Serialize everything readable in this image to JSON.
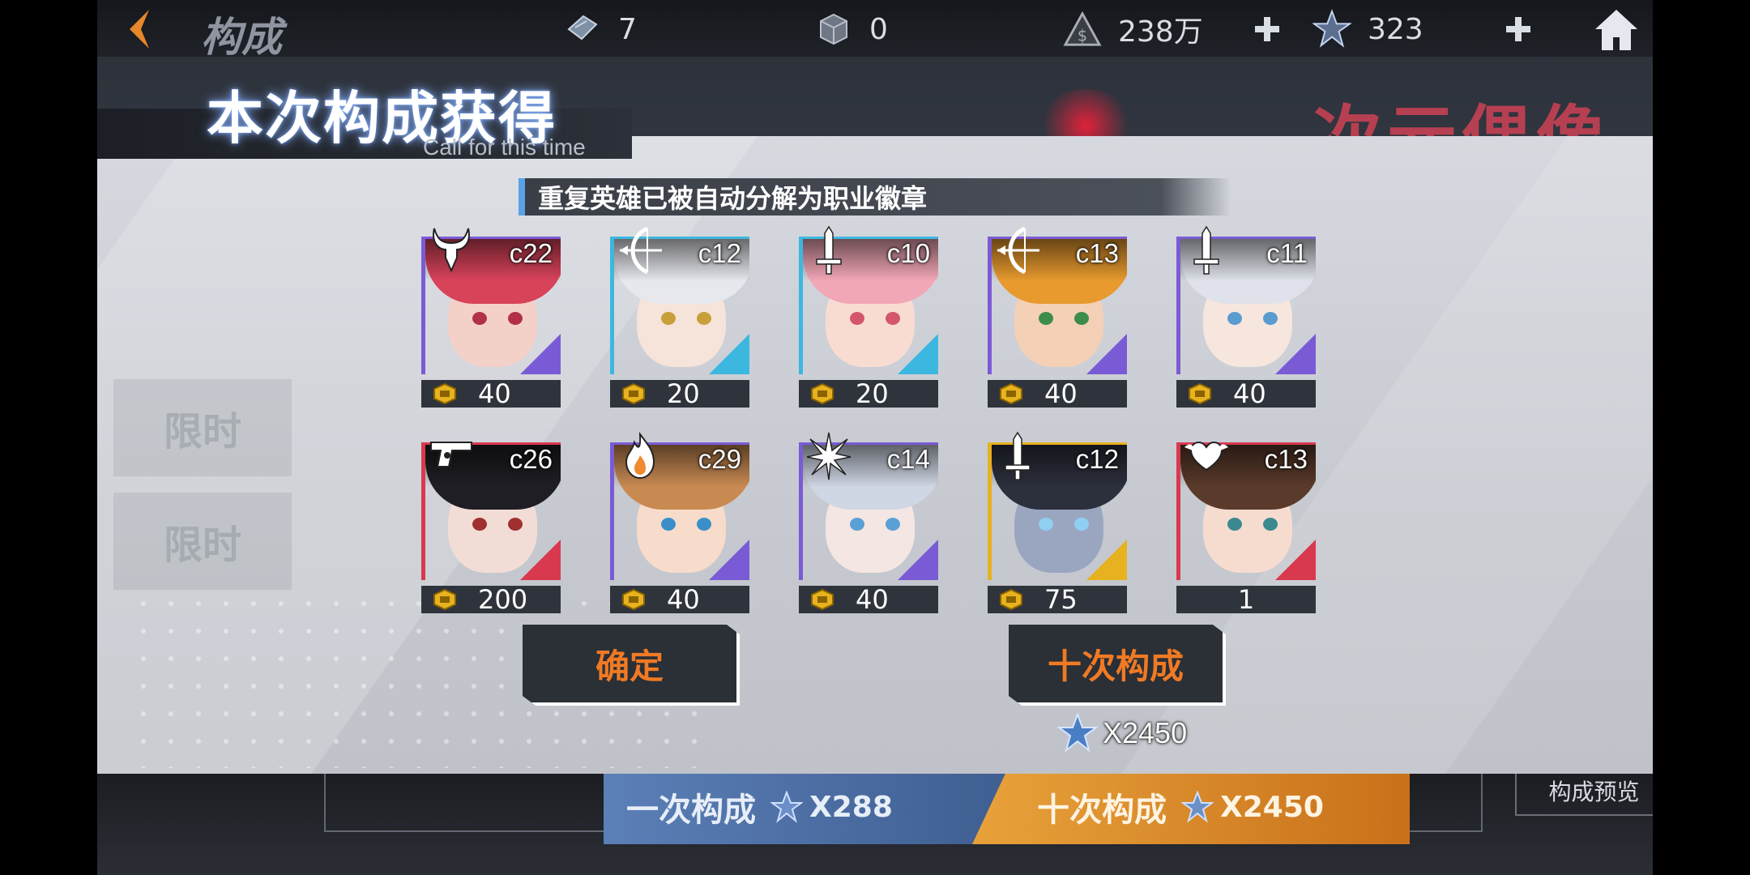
{
  "topbar": {
    "title": "构成",
    "res_ticket": "7",
    "res_cube": "0",
    "res_gold": "238万",
    "res_crystal": "323"
  },
  "background": {
    "banner_text": "次元偶像",
    "ghost_left_1": "限时",
    "ghost_left_2": "限时",
    "once_label": "一次构成",
    "once_price": "X288",
    "ten_label": "十次构成",
    "ten_price": "X2450",
    "preview_label": "构成预览"
  },
  "result": {
    "title": "本次构成获得",
    "subtitle": "Call for this time",
    "notice": "重复英雄已被自动分解为职业徽章",
    "cards": [
      {
        "cls_icon": "demon-horns-icon",
        "cost": "c22",
        "badge": "40",
        "accent": "#7a5bd6",
        "hair": "#d9435a",
        "skin": "#f4d1c8",
        "eye": "#b2304a"
      },
      {
        "cls_icon": "bow-icon",
        "cost": "c12",
        "badge": "20",
        "accent": "#3cb7e0",
        "hair": "#e6e8ee",
        "skin": "#f6e3d9",
        "eye": "#c7a03a"
      },
      {
        "cls_icon": "sword-icon",
        "cost": "c10",
        "badge": "20",
        "accent": "#3cb7e0",
        "hair": "#f2a7b6",
        "skin": "#f8dcd2",
        "eye": "#d4566c"
      },
      {
        "cls_icon": "bow-icon",
        "cost": "c13",
        "badge": "40",
        "accent": "#7a5bd6",
        "hair": "#e89a2e",
        "skin": "#f4d0b6",
        "eye": "#3c8d4a"
      },
      {
        "cls_icon": "sword-icon",
        "cost": "c11",
        "badge": "40",
        "accent": "#7a5bd6",
        "hair": "#dfe2ea",
        "skin": "#f6e6de",
        "eye": "#5a9bd0"
      },
      {
        "cls_icon": "pistol-icon",
        "cost": "c26",
        "badge": "200",
        "accent": "#d8394f",
        "hair": "#1e1e24",
        "skin": "#f2ddd6",
        "eye": "#a03030"
      },
      {
        "cls_icon": "flame-icon",
        "cost": "c29",
        "badge": "40",
        "accent": "#7a5bd6",
        "hair": "#c98a52",
        "skin": "#f7dccb",
        "eye": "#3a8fc9"
      },
      {
        "cls_icon": "star-burst-icon",
        "cost": "c14",
        "badge": "40",
        "accent": "#7a5bd6",
        "hair": "#cfd6e4",
        "skin": "#f4e6e2",
        "eye": "#5aa0d6"
      },
      {
        "cls_icon": "sword-icon",
        "cost": "c12",
        "badge": "75",
        "accent": "#e6b21f",
        "hair": "#2c2f3c",
        "skin": "#9aa6c0",
        "eye": "#8fd0f2"
      },
      {
        "cls_icon": "heart-wings-icon",
        "cost": "c13",
        "badge": "1",
        "accent": "#d8394f",
        "hair": "#5a3a2a",
        "skin": "#f6dccf",
        "eye": "#3a8a8f"
      }
    ],
    "confirm_label": "确定",
    "ten_pull_label": "十次构成",
    "ten_pull_cost": "X2450"
  }
}
